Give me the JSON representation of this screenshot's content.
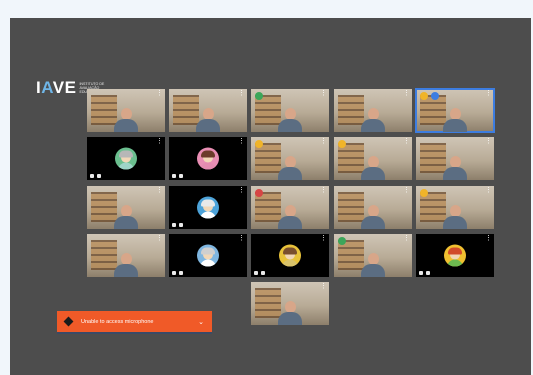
{
  "logo": {
    "mark_a": "I",
    "mark_b": "A",
    "mark_c": "VE",
    "subtitle": "Instituto de Avaliação Educativa"
  },
  "banner": {
    "message": "Unable to access microphone"
  },
  "tiles": [
    {
      "kind": "cam"
    },
    {
      "kind": "cam"
    },
    {
      "kind": "cam",
      "badge": "green"
    },
    {
      "kind": "cam"
    },
    {
      "kind": "cam",
      "badge": "yellow",
      "badge2": true,
      "active": true
    },
    {
      "kind": "avatar",
      "hair": "#b7b7b7",
      "shirt": "#9ed4c8",
      "bg": "#6bbf8f"
    },
    {
      "kind": "avatar",
      "hair": "#6b3b2a",
      "shirt": "#e48bb0",
      "bg": "#e98eb4"
    },
    {
      "kind": "cam",
      "badge": "yellow"
    },
    {
      "kind": "cam",
      "badge": "yellow"
    },
    {
      "kind": "cam"
    },
    {
      "kind": "cam"
    },
    {
      "kind": "avatar",
      "hair": "#e9e9e9",
      "shirt": "#ffffff",
      "bg": "#4da3d9"
    },
    {
      "kind": "cam",
      "badge": "red"
    },
    {
      "kind": "cam"
    },
    {
      "kind": "cam",
      "badge": "yellow"
    },
    {
      "kind": "cam"
    },
    {
      "kind": "avatar",
      "hair": "#cfcfcf",
      "shirt": "#ffffff",
      "bg": "#7fb6e0"
    },
    {
      "kind": "avatar",
      "hair": "#7a4e2d",
      "shirt": "#d9c36a",
      "bg": "#e8c23a"
    },
    {
      "kind": "cam",
      "badge": "green"
    },
    {
      "kind": "avatar",
      "hair": "#d14b2b",
      "shirt": "#6dbb50",
      "bg": "#f0c030"
    },
    {
      "kind": "cam"
    }
  ]
}
